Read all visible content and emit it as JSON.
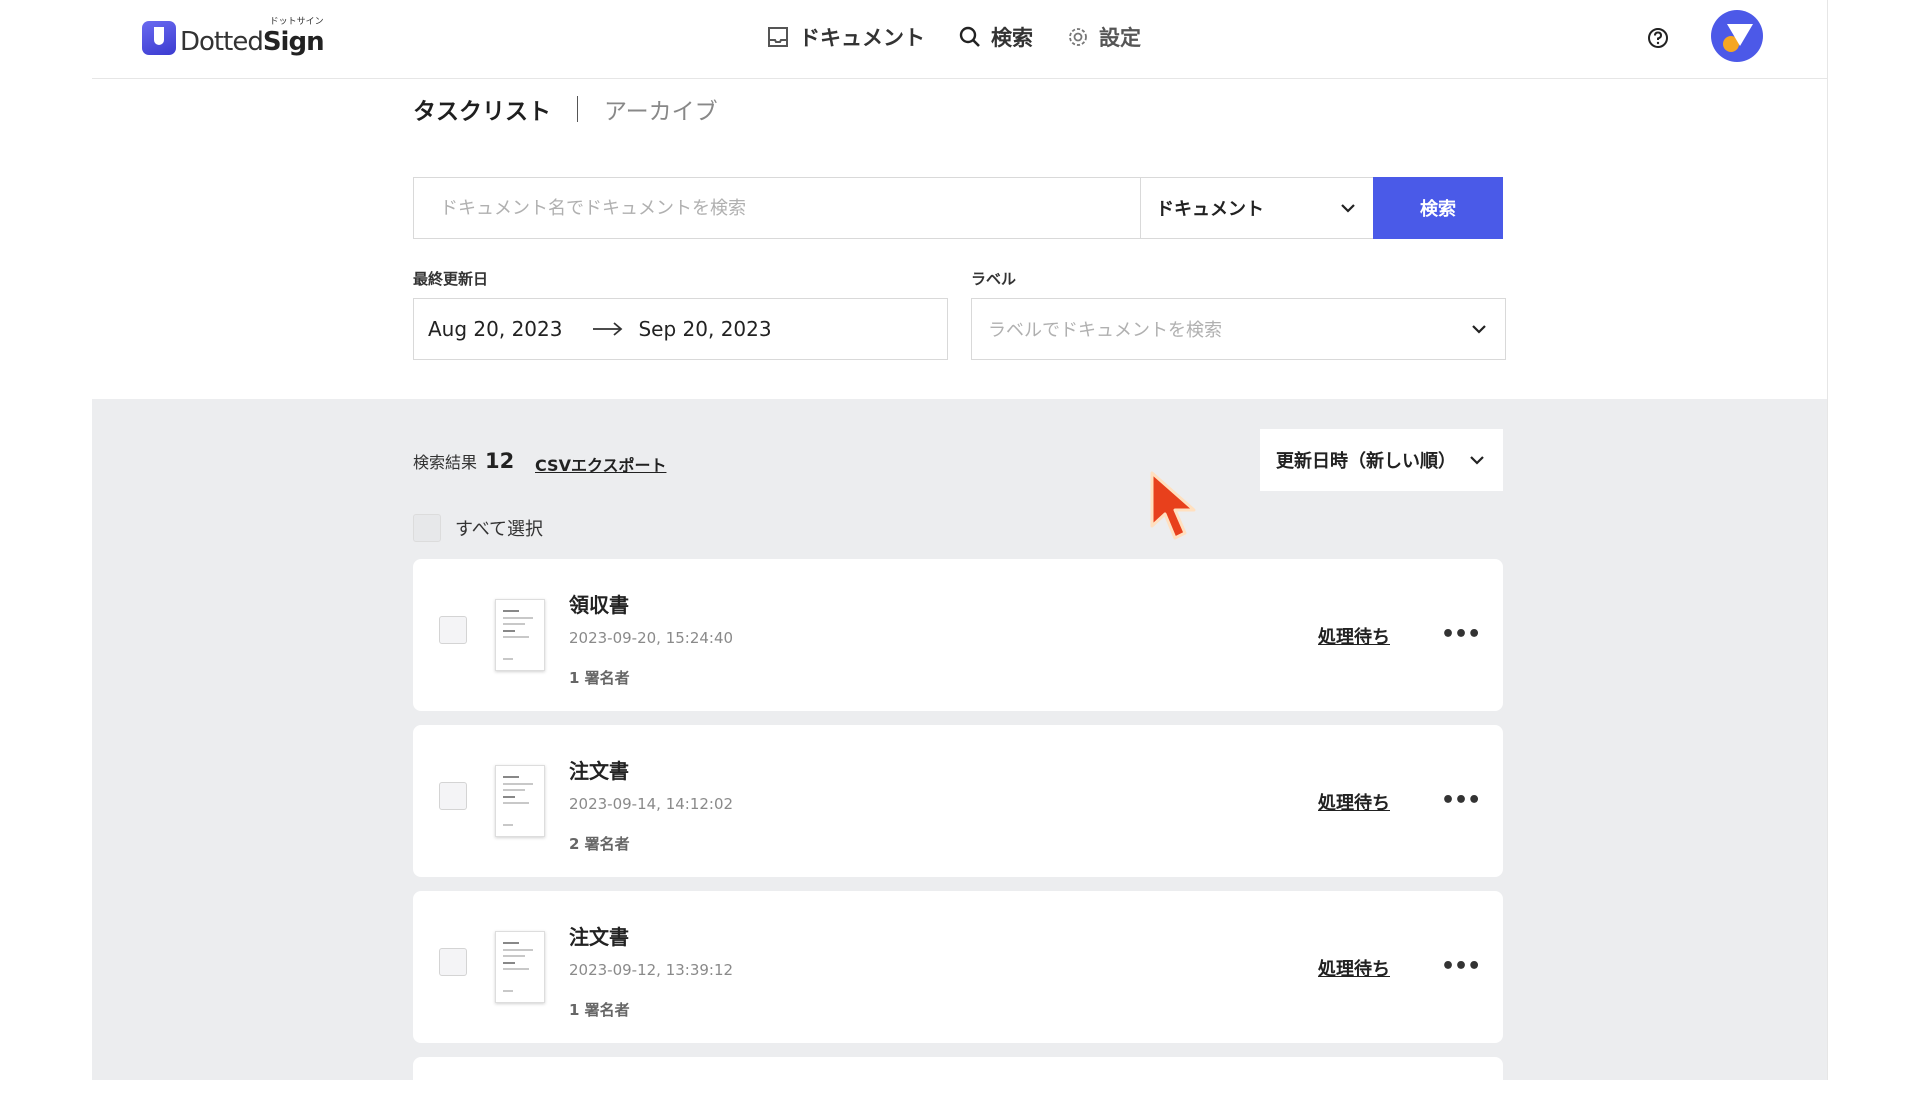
{
  "header": {
    "logo_ruby": "ドットサイン",
    "logo_name_part1": "Dotted",
    "logo_name_part2": "Sign",
    "nav": [
      {
        "label": "ドキュメント",
        "icon": "inbox-icon"
      },
      {
        "label": "検索",
        "icon": "search-icon"
      },
      {
        "label": "設定",
        "icon": "gear-icon"
      }
    ],
    "help_icon": "help-circle-icon",
    "avatar_colors": {
      "bg": "#4c59e8",
      "dot": "#f5a623"
    }
  },
  "tabs": [
    {
      "label": "タスクリスト",
      "active": true
    },
    {
      "label": "アーカイブ",
      "active": false
    }
  ],
  "search": {
    "placeholder": "ドキュメント名でドキュメントを検索",
    "value": "",
    "type_select": "ドキュメント",
    "button": "検索"
  },
  "filters": {
    "date_label": "最終更新日",
    "date_from": "Aug 20, 2023",
    "date_to": "Sep 20, 2023",
    "label_label": "ラベル",
    "label_placeholder": "ラベルでドキュメントを検索"
  },
  "results": {
    "count_label": "検索結果",
    "count": "12",
    "csv_export": "CSVエクスポート",
    "sort": "更新日時（新しい順）",
    "select_all": "すべて選択",
    "items": [
      {
        "title": "領収書",
        "date": "2023-09-20, 15:24:40",
        "signers": "1 署名者",
        "status": "処理待ち"
      },
      {
        "title": "注文書",
        "date": "2023-09-14, 14:12:02",
        "signers": "2 署名者",
        "status": "処理待ち"
      },
      {
        "title": "注文書",
        "date": "2023-09-12, 13:39:12",
        "signers": "1 署名者",
        "status": "処理待ち"
      }
    ],
    "more_glyph": "•••"
  },
  "colors": {
    "accent": "#4a5ae8",
    "results_bg": "#ecedef",
    "cursor": "#e8401c"
  }
}
